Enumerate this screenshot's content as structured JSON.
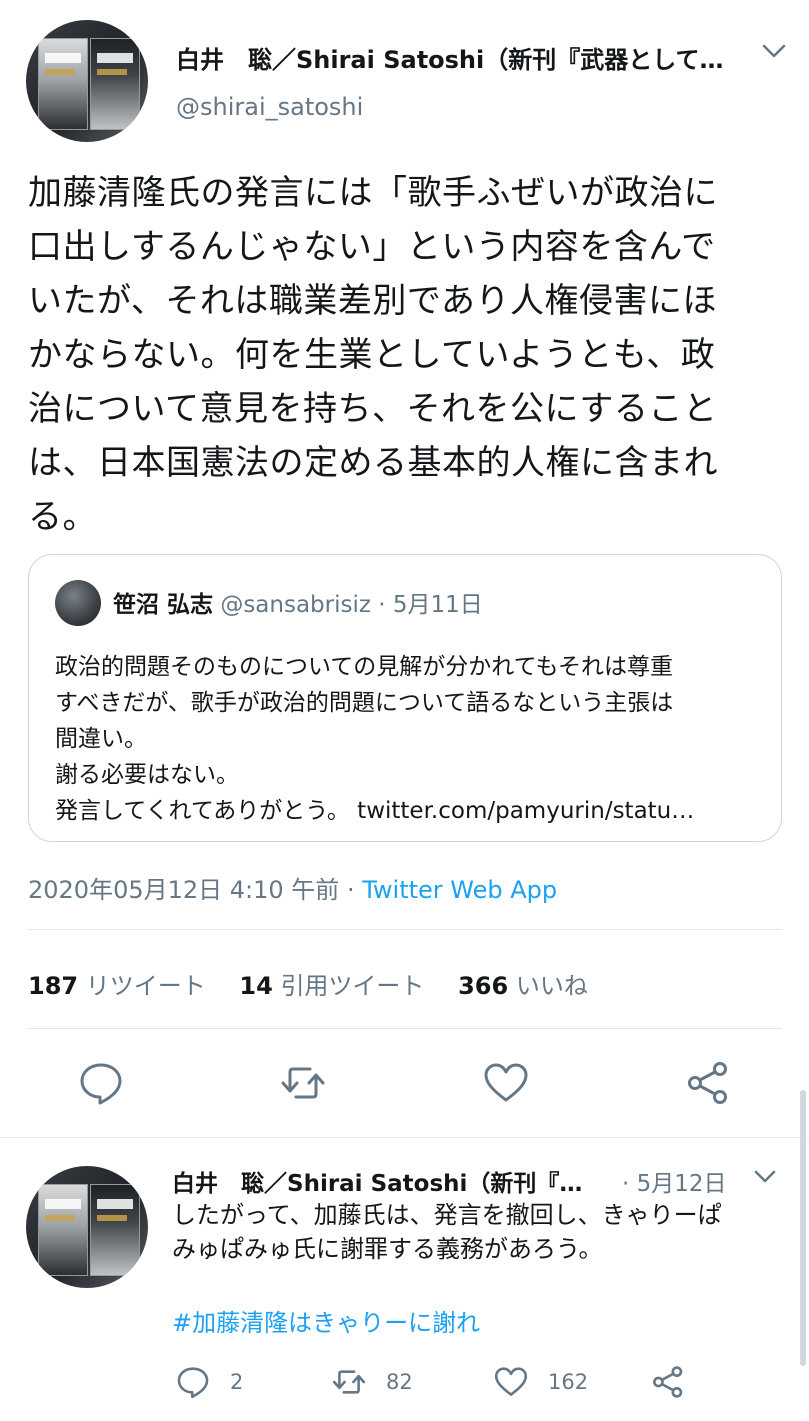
{
  "main_tweet": {
    "display_name": "白井　聡／Shirai Satoshi（新刊『武器として…",
    "username": "@shirai_satoshi",
    "text_lines": [
      "加藤清隆氏の発言には「歌手ふぜいが政治に",
      "口出しするんじゃない」という内容を含んで",
      "いたが、それは職業差別であり人権侵害にほ",
      "かならない。何を生業としていようとも、政",
      "治について意見を持ち、それを公にすること",
      "は、日本国憲法の定める基本的人権に含まれ",
      "る。"
    ],
    "quote": {
      "name": "笹沼 弘志",
      "handle": "@sansabrisiz",
      "separator": "·",
      "date": "5月11日",
      "text_lines": [
        "政治的問題そのものについての見解が分かれてもそれは尊重",
        "すべきだが、歌手が政治的問題について語るなという主張は",
        "間違い。",
        "謝る必要はない。",
        "発言してくれてありがとう。 twitter.com/pamyurin/statu…"
      ]
    },
    "timestamp": "2020年05月12日 4:10 午前",
    "meta_separator": " · ",
    "source": "Twitter Web App",
    "stats": {
      "retweets_count": "187",
      "retweets_label": "リツイート",
      "quotes_count": "14",
      "quotes_label": "引用ツイート",
      "likes_count": "366",
      "likes_label": "いいね"
    },
    "actions": [
      "reply-icon",
      "retweet-icon",
      "like-icon",
      "share-icon"
    ]
  },
  "reply_tweet": {
    "display_name": "白井　聡／Shirai Satoshi（新刊『…",
    "date": "· 5月12日",
    "text_lines": [
      "したがって、加藤氏は、発言を撤回し、きゃりーぱ",
      "みゅぱみゅ氏に謝罪する義務があろう。"
    ],
    "hashtag": "#加藤清隆はきゃりーに謝れ",
    "replies": "2",
    "retweets": "82",
    "likes": "162"
  },
  "colors": {
    "text": "#14171a",
    "secondary": "#657786",
    "accent": "#1da1f2",
    "border": "#e1e8ed",
    "icon": "#657786"
  }
}
